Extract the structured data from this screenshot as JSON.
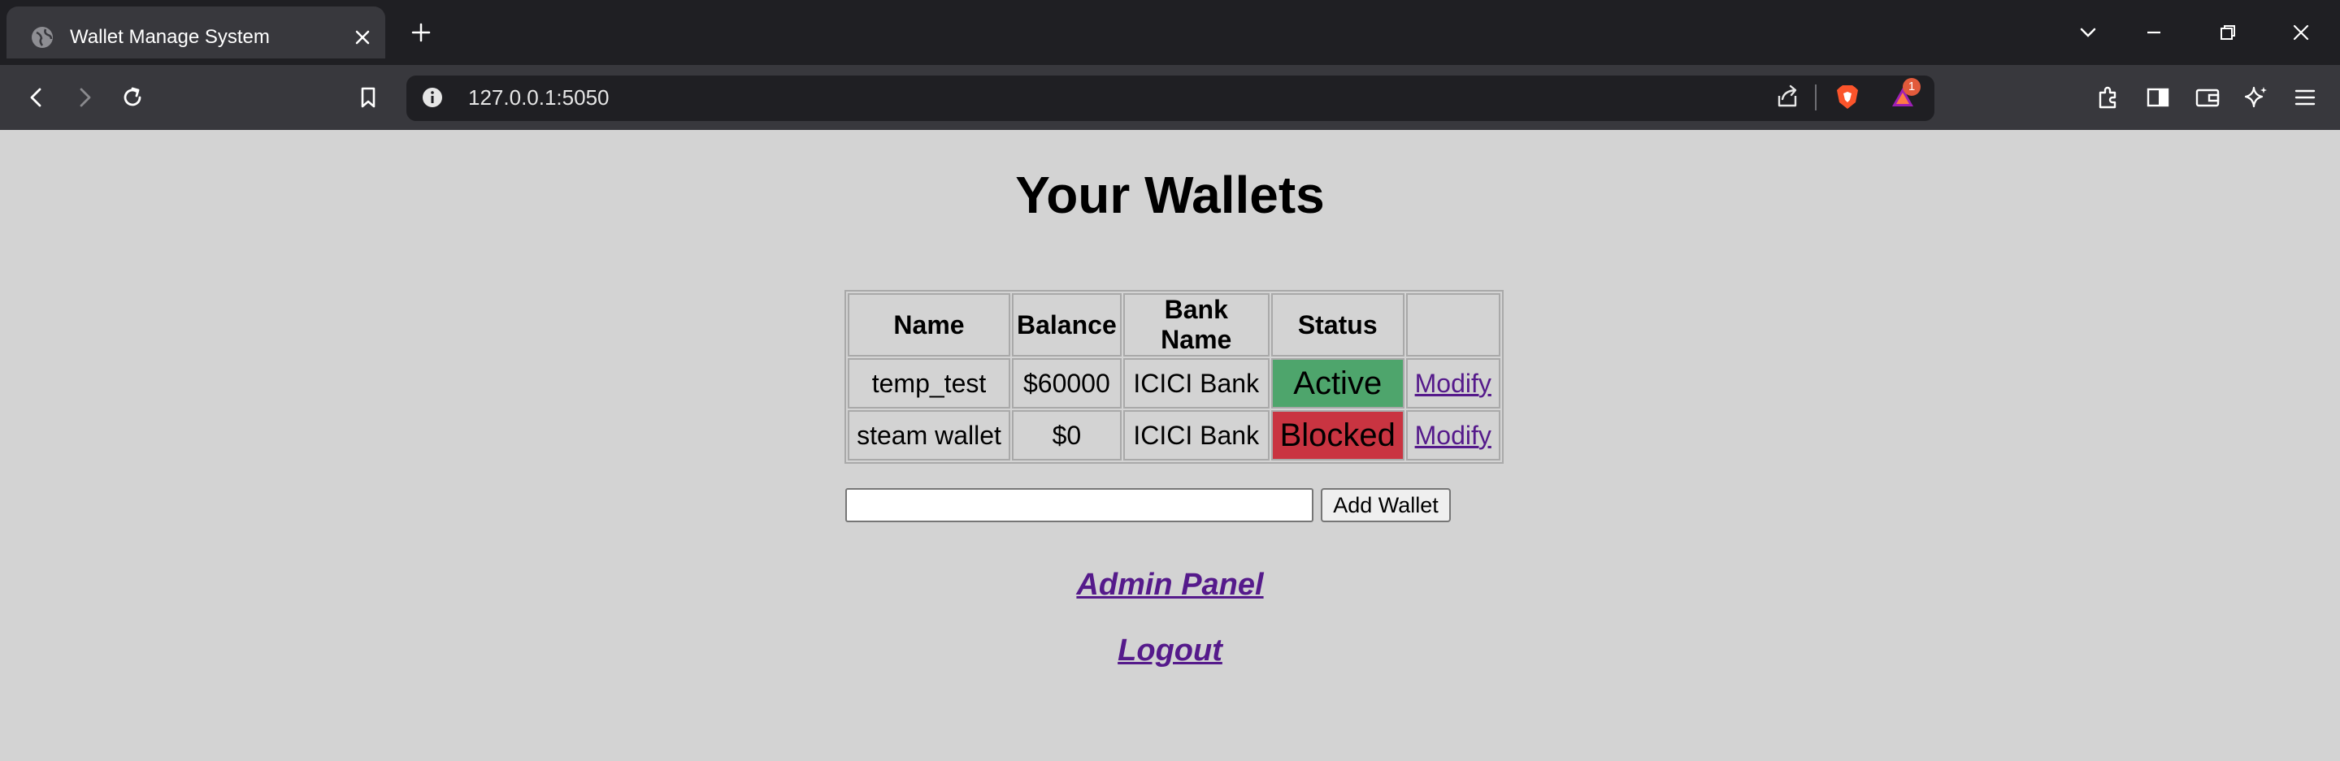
{
  "browser": {
    "tab_title": "Wallet Manage System",
    "url": "127.0.0.1:5050",
    "notification_count": "1"
  },
  "page": {
    "title": "Your Wallets",
    "table": {
      "headers": [
        "Name",
        "Balance",
        "Bank Name",
        "Status",
        ""
      ],
      "rows": [
        {
          "name": "temp_test",
          "balance": "$60000",
          "bank": "ICICI Bank",
          "status": "Active",
          "status_color": "#4ea56c",
          "action": "Modify"
        },
        {
          "name": "steam wallet",
          "balance": "$0",
          "bank": "ICICI Bank",
          "status": "Blocked",
          "status_color": "#c93441",
          "action": "Modify"
        }
      ]
    },
    "add_wallet": {
      "input_value": "",
      "button_label": "Add Wallet"
    },
    "links": {
      "admin_panel": "Admin Panel",
      "logout": "Logout"
    }
  },
  "colors": {
    "page_background": "#d3d3d3",
    "link": "#551a8b"
  }
}
